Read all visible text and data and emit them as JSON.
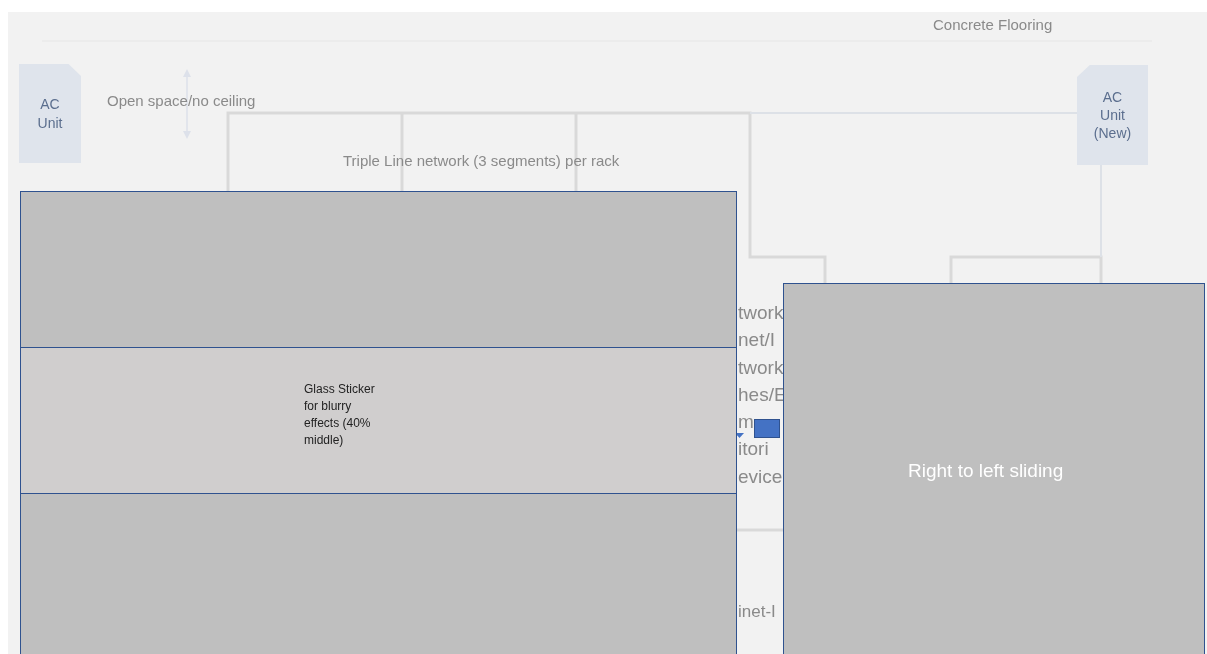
{
  "canvas": {
    "floor_label": "Concrete Flooring",
    "ac_units": [
      {
        "label": "AC Unit"
      },
      {
        "label": "AC Unit (New)"
      }
    ],
    "ceiling_label": "Open space/no ceiling",
    "network_label": "Triple Line network (3 segments) per rack",
    "partial_labels": [
      "twork",
      "net/I",
      "twork",
      "hes/E",
      "m",
      "itori",
      "evice"
    ],
    "lower_partial_label": "inet-I"
  },
  "overlays": {
    "glass_sticker": "Glass Sticker for blurry effects (40% middle)",
    "sliding_panel": "Right to left sliding"
  }
}
